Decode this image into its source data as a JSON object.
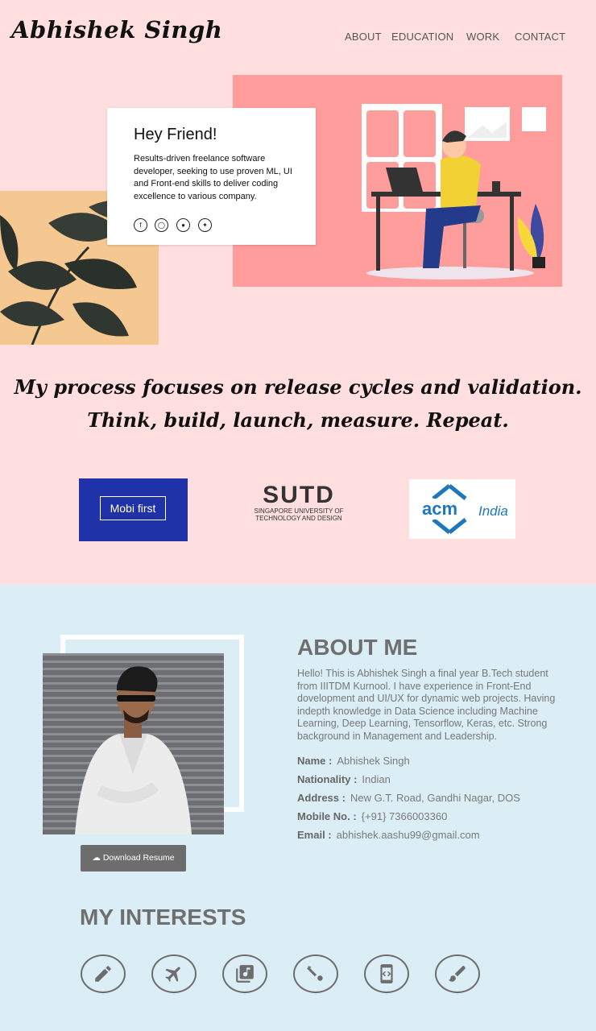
{
  "header": {
    "brand": "Abhishek Singh",
    "nav": [
      "ABOUT",
      "EDUCATION",
      "WORK",
      "CONTACT"
    ]
  },
  "hero": {
    "greeting": "Hey Friend!",
    "intro": "Results-driven freelance software developer, seeking to use proven ML, UI and Front-end skills to deliver coding excellence to various company.",
    "social": [
      "facebook-icon",
      "instagram-icon",
      "globe-icon",
      "twitter-icon"
    ]
  },
  "quote": {
    "line1": "My process focuses on release cycles and validation.",
    "line2": "Think, build, launch, measure. Repeat."
  },
  "logos": {
    "mobi": "Mobi first",
    "sutd_big": "SUTD",
    "sutd_line1": "SINGAPORE UNIVERSITY OF",
    "sutd_line2": "TECHNOLOGY AND DESIGN",
    "acm": "acm",
    "acm_india": "India"
  },
  "about": {
    "title": "ABOUT ME",
    "text": "Hello! This is Abhishek Singh a final year B.Tech student from IIITDM Kurnool. I have experience in Front-End dovelopment and UI/UX for dynamic web projects. Having indepth knowledge in Data Science including Machine Learning, Deep Learning, Tensorflow, Keras, etc. Strong background in Management and Leadership.",
    "download": "Download Resume",
    "info": [
      {
        "label": "Name :",
        "value": "Abhishek Singh"
      },
      {
        "label": "Nationality :",
        "value": "Indian"
      },
      {
        "label": "Address :",
        "value": "New G.T. Road, Gandhi Nagar, DOS"
      },
      {
        "label": "Mobile No. :",
        "value": "{+91} 7366003360"
      },
      {
        "label": "Email :",
        "value": "abhishek.aashu99@gmail.com"
      }
    ]
  },
  "interests": {
    "title": "MY INTERESTS",
    "icons": [
      "pencil-icon",
      "airplane-icon",
      "music-library-icon",
      "sports-icon",
      "app-code-icon",
      "brush-icon"
    ]
  },
  "colors": {
    "pink_bg": "#ffdedf",
    "blue_bg": "#dbeef5",
    "hero_bg": "#ff9c9c",
    "mobi_blue": "#2032a7"
  }
}
